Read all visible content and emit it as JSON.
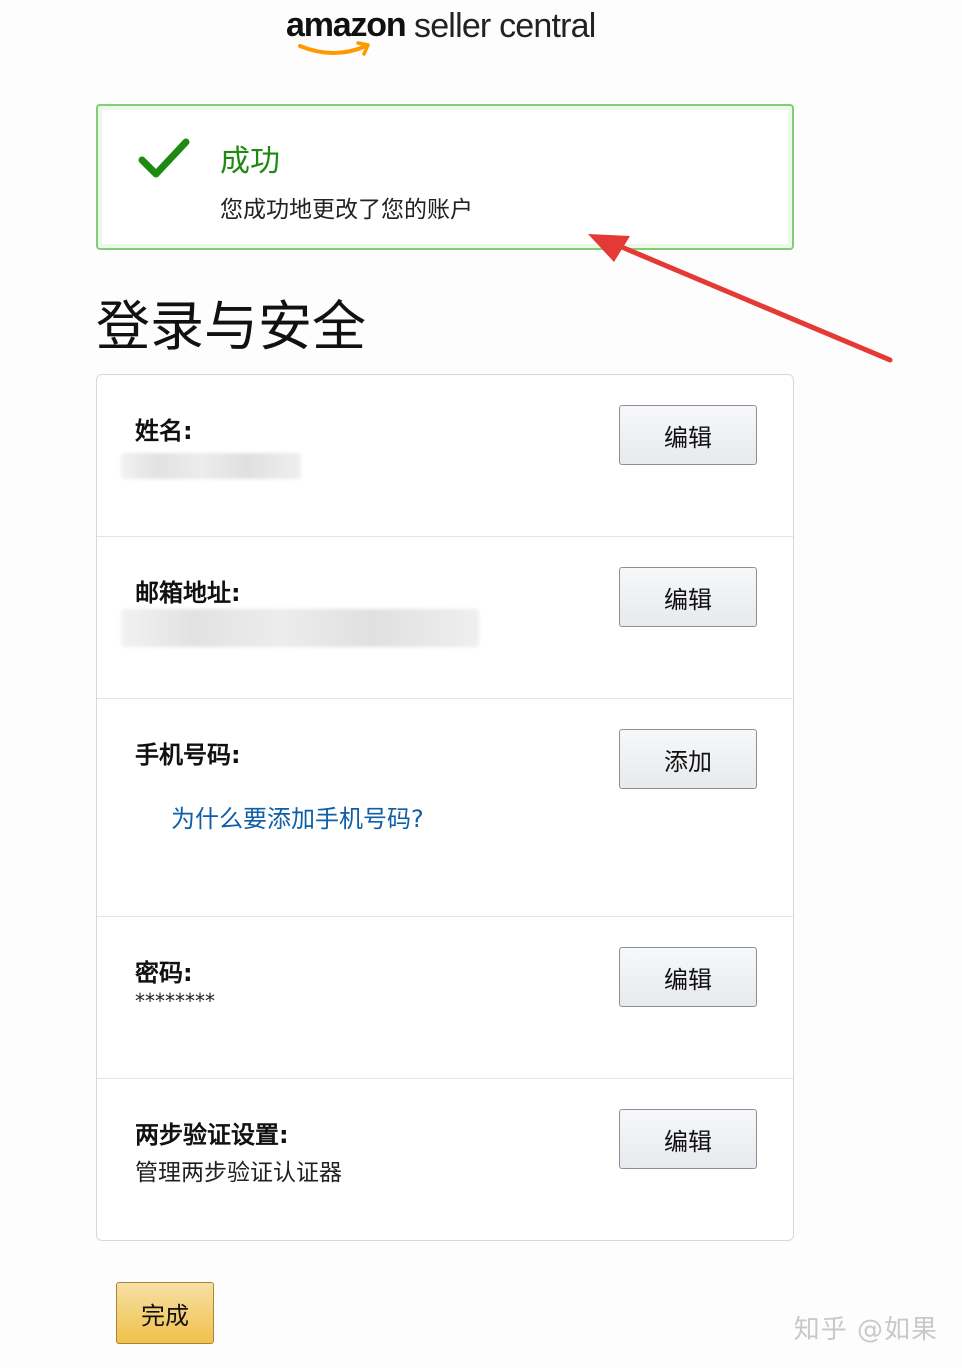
{
  "logo": {
    "brand": "amazon",
    "product": "seller central"
  },
  "alert": {
    "icon": "check-icon",
    "title": "成功",
    "message": "您成功地更改了您的账户",
    "color": "#1e8a12"
  },
  "page_title": "登录与安全",
  "sections": {
    "name": {
      "label": "姓名:",
      "button": "编辑"
    },
    "email": {
      "label": "邮箱地址:",
      "button": "编辑"
    },
    "phone": {
      "label": "手机号码:",
      "link": "为什么要添加手机号码?",
      "button": "添加"
    },
    "password": {
      "label": "密码:",
      "value": "********",
      "button": "编辑"
    },
    "two_step": {
      "label": "两步验证设置:",
      "value": "管理两步验证认证器",
      "button": "编辑"
    }
  },
  "done_button": "完成",
  "watermark": "知乎 @如果",
  "colors": {
    "success": "#1e8a12",
    "success_border": "#7fcf77",
    "link": "#0f5ea8",
    "primary_button": "#f0c14b",
    "annotation_arrow": "#e53935"
  }
}
